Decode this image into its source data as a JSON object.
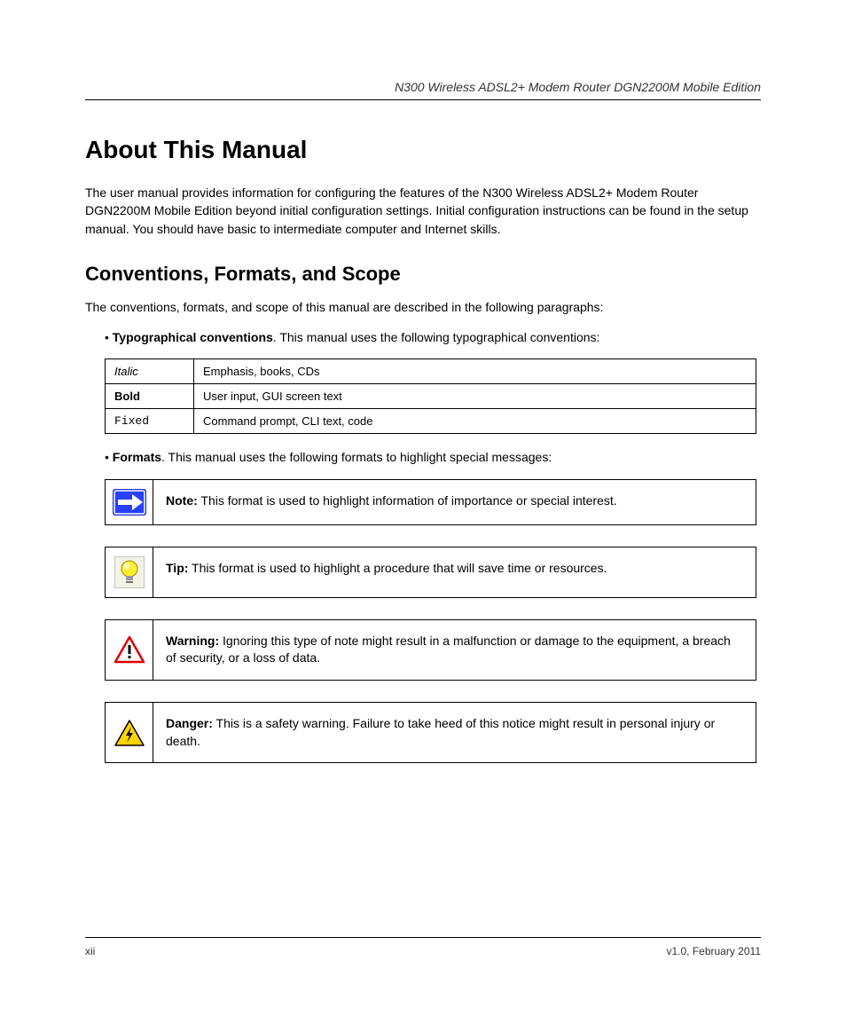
{
  "running_header": "N300 Wireless ADSL2+ Modem Router DGN2200M Mobile Edition",
  "title": "About This Manual",
  "intro_p1": "The user manual provides information for configuring the features of the N300 Wireless ADSL2+ Modem Router DGN2200M Mobile Edition beyond initial configuration settings. Initial configuration instructions can be found in the setup manual. You should have basic to intermediate computer and Internet skills.",
  "section_heading": "Conventions, Formats, and Scope",
  "conv_p1": "The conventions, formats, and scope of this manual are described in the following paragraphs:",
  "conv_bullet_lead": "Typographical conventions",
  "conv_bullet_tail": ". This manual uses the following typographical conventions:",
  "table": {
    "rows": [
      {
        "c1": "Italic",
        "c2": "Emphasis, books, CDs",
        "c1_style": "italic"
      },
      {
        "c1": "Bold",
        "c2": "User input, GUI screen text",
        "c1_style": "bold"
      },
      {
        "c1": "Fixed",
        "c2": "Command prompt, CLI text, code",
        "c1_style": "mono"
      }
    ]
  },
  "formats_bullet_lead": "Formats",
  "formats_bullet_tail": ". This manual uses the following formats to highlight special messages:",
  "callouts": [
    {
      "icon": "note",
      "label": "Note:",
      "text": " This format is used to highlight information of importance or special interest."
    },
    {
      "icon": "tip",
      "label": "Tip:",
      "text": " This format is used to highlight a procedure that will save time or resources."
    },
    {
      "icon": "warning",
      "label": "Warning:",
      "text": " Ignoring this type of note might result in a malfunction or damage to the equipment, a breach of security, or a loss of data."
    },
    {
      "icon": "danger",
      "label": "Danger:",
      "text": " This is a safety warning. Failure to take heed of this notice might result in personal injury or death."
    }
  ],
  "footer": {
    "left": "xii",
    "right": "v1.0, February 2011"
  }
}
